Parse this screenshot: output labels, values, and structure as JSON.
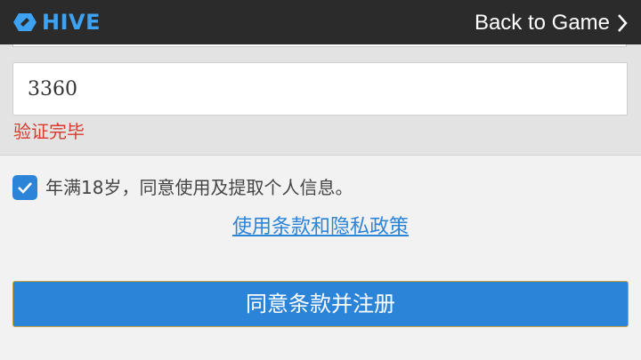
{
  "header": {
    "logo_text": "HIVE",
    "back_label": "Back to Game"
  },
  "form": {
    "code_value": "3360",
    "verify_message": "验证完毕"
  },
  "consent": {
    "checked": true,
    "text": "年满18岁，同意使用及提取个人信息。"
  },
  "terms_link": "使用条款和隐私政策",
  "submit_label": "同意条款并注册",
  "colors": {
    "topbar": "#2b2b2b",
    "brand": "#3ea2f2",
    "accent": "#2c84d9",
    "error": "#d83a2e"
  },
  "icons": {
    "logo": "hive-logo-icon",
    "back": "chevron-right-icon",
    "check": "checkmark-icon"
  }
}
